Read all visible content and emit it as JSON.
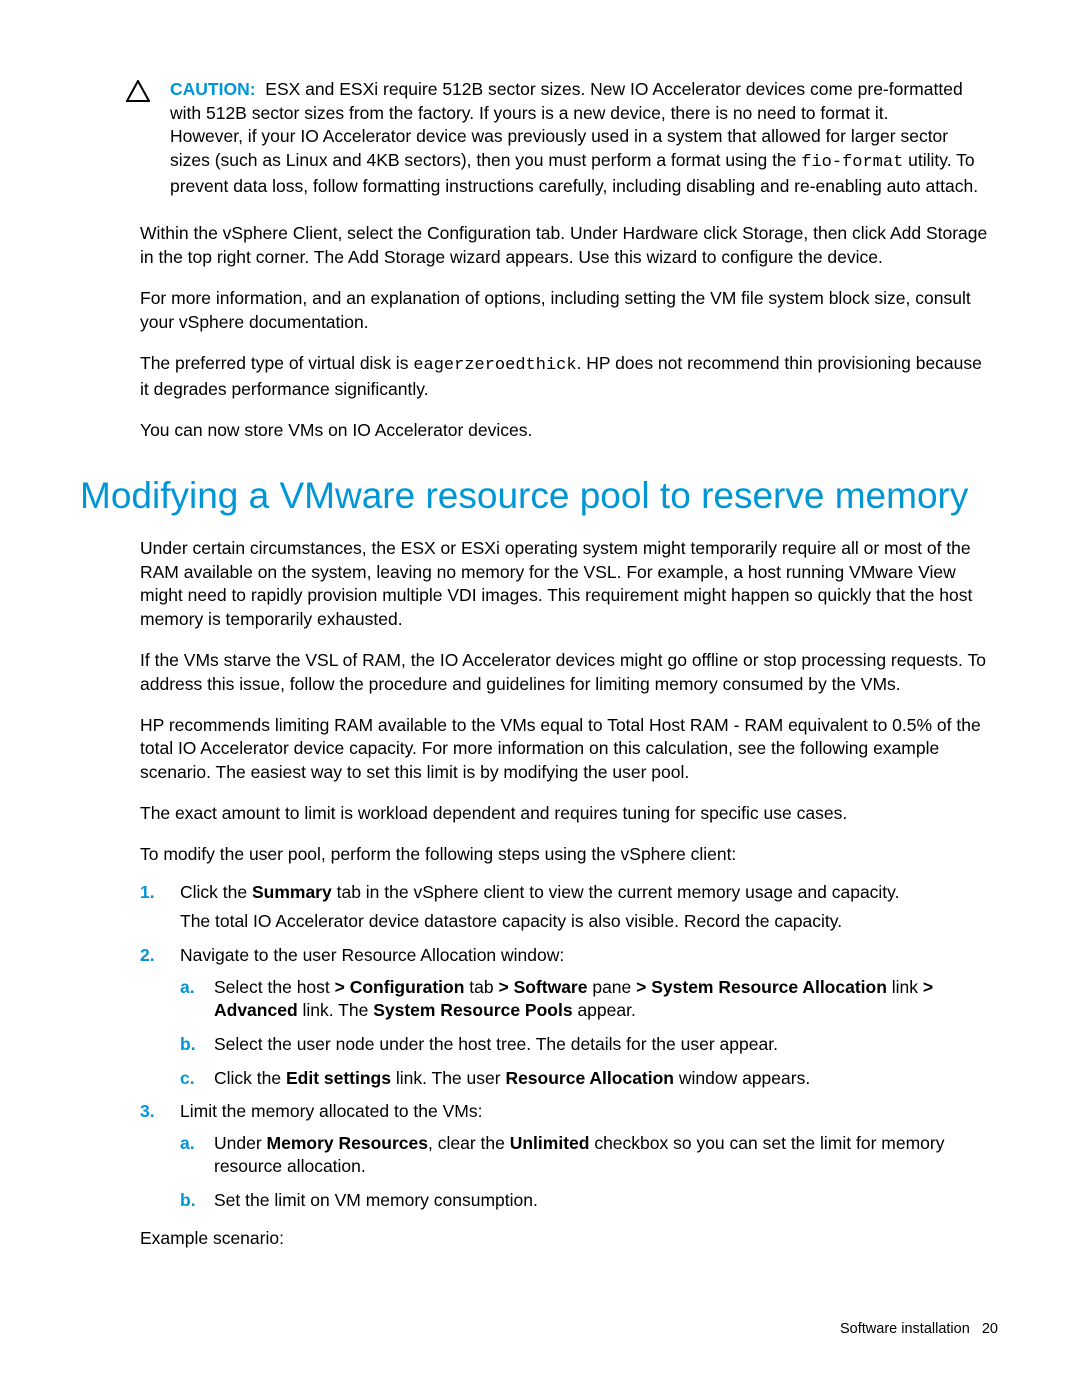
{
  "caution": {
    "label": "CAUTION:",
    "para1a": "ESX and ESXi require 512B sector sizes. New IO Accelerator devices come pre-formatted with 512B sector sizes from the factory. If yours is a new device, there is no need to format it.",
    "para2a": "However, if your IO Accelerator device was previously used in a system that allowed for larger sector sizes (such as Linux and 4KB sectors), then you must perform a format using the ",
    "code": "fio-format",
    "para2b": " utility. To prevent data loss, follow formatting instructions carefully, including disabling and re-enabling auto attach."
  },
  "intro": {
    "p1": "Within the vSphere Client, select the Configuration tab. Under Hardware click Storage, then click Add Storage in the top right corner. The Add Storage wizard appears. Use this wizard to configure the device.",
    "p2": "For more information, and an explanation of options, including setting the VM file system block size, consult your vSphere documentation.",
    "p3a": "The preferred type of virtual disk is ",
    "p3code": "eagerzeroedthick",
    "p3b": ". HP does not recommend thin provisioning because it degrades performance significantly.",
    "p4": "You can now store VMs on IO Accelerator devices."
  },
  "heading": "Modifying a VMware resource pool to reserve memory",
  "section": {
    "p1": "Under certain circumstances, the ESX or ESXi operating system might temporarily require all or most of the RAM available on the system, leaving no memory for the VSL. For example, a host running VMware View might need to rapidly provision multiple VDI images. This requirement might happen so quickly that the host memory is temporarily exhausted.",
    "p2": "If the VMs starve the VSL of RAM, the IO Accelerator devices might go offline or stop processing requests. To address this issue, follow the procedure and guidelines for limiting memory consumed by the VMs.",
    "p3": "HP recommends limiting RAM available to the VMs equal to Total Host RAM - RAM equivalent to 0.5% of the total IO Accelerator device capacity. For more information on this calculation, see the following example scenario. The easiest way to set this limit is by modifying the user pool.",
    "p4": "The exact amount to limit is workload dependent and requires tuning for specific use cases.",
    "p5": "To modify the user pool, perform the following steps using the vSphere client:"
  },
  "steps": {
    "s1": {
      "marker": "1.",
      "text_a": "Click the ",
      "bold1": "Summary",
      "text_b": " tab in the vSphere client to view the current memory usage and capacity.",
      "sub": "The total IO Accelerator device datastore capacity is also visible. Record the capacity."
    },
    "s2": {
      "marker": "2.",
      "text": "Navigate to the user Resource Allocation window:",
      "a": {
        "marker": "a.",
        "t1": "Select the host ",
        "b1": "> Configuration",
        "t2": " tab ",
        "b2": "> Software",
        "t3": " pane ",
        "b3": "> System Resource Allocation",
        "t4": " link ",
        "b4": "> Advanced",
        "t5": " link. The ",
        "b5": "System Resource Pools",
        "t6": " appear."
      },
      "b": {
        "marker": "b.",
        "text": "Select the user node under the host tree. The details for the user appear."
      },
      "c": {
        "marker": "c.",
        "t1": "Click the ",
        "b1": "Edit settings",
        "t2": " link. The user ",
        "b2": "Resource Allocation",
        "t3": " window appears."
      }
    },
    "s3": {
      "marker": "3.",
      "text": "Limit the memory allocated to the VMs:",
      "a": {
        "marker": "a.",
        "t1": "Under ",
        "b1": "Memory Resources",
        "t2": ", clear the ",
        "b2": "Unlimited",
        "t3": " checkbox so you can set the limit for memory resource allocation."
      },
      "b": {
        "marker": "b.",
        "text": "Set the limit on VM memory consumption."
      }
    }
  },
  "example_label": "Example scenario:",
  "footer": {
    "text": "Software installation",
    "page": "20"
  }
}
